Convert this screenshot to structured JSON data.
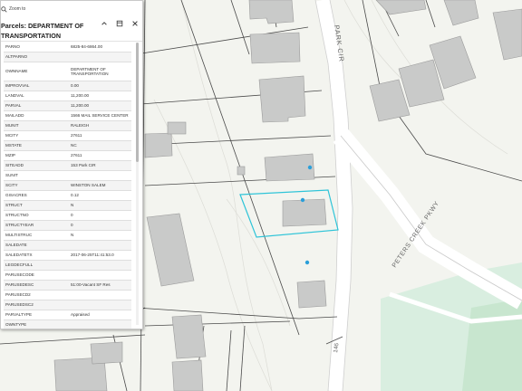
{
  "map": {
    "road_labels": [
      "PARK CIR",
      "PETERS CREEK PKWY",
      "146"
    ],
    "colors": {
      "background": "#f3f4ef",
      "building": "#c9cac9",
      "building_stroke": "#9b9b9b",
      "parcel_line": "#4a4a4a",
      "road": "#ffffff",
      "park": "#d9eee0",
      "highlight": "#2ec4d8",
      "marker": "#2b9fd9"
    }
  },
  "popup": {
    "zoom_label": "Zoom to",
    "title": "Parcels: DEPARTMENT OF TRANSPORTATION",
    "icons": [
      "chevron-up-icon",
      "dock-icon",
      "close-icon"
    ],
    "rows": [
      {
        "field": "PARNO",
        "value": "6825-84-6864.00"
      },
      {
        "field": "ALTPARNO",
        "value": ""
      },
      {
        "field": "OWNNAME",
        "value": "DEPARTMENT OF TRANSPORTATION"
      },
      {
        "field": "IMPROVVAL",
        "value": "0.00"
      },
      {
        "field": "LANDVAL",
        "value": "11,200.00"
      },
      {
        "field": "PARVAL",
        "value": "11,200.00"
      },
      {
        "field": "MAILADD",
        "value": "1566 MAIL SERVICE CENTER"
      },
      {
        "field": "MUNIT",
        "value": "RALEIGH"
      },
      {
        "field": "MCITY",
        "value": "27611"
      },
      {
        "field": "MSTATE",
        "value": "NC"
      },
      {
        "field": "MZIP",
        "value": "27611"
      },
      {
        "field": "SITEADD",
        "value": "153 Park CIR"
      },
      {
        "field": "SUNIT",
        "value": ""
      },
      {
        "field": "SCITY",
        "value": "WINSTON SALEM"
      },
      {
        "field": "GISACRES",
        "value": "0.12"
      },
      {
        "field": "STRUCT",
        "value": "N"
      },
      {
        "field": "STRUCTNO",
        "value": "0"
      },
      {
        "field": "STRUCTYEAR",
        "value": "0"
      },
      {
        "field": "MULTISTRUC",
        "value": "N"
      },
      {
        "field": "SALEDATE",
        "value": ""
      },
      {
        "field": "SALEDATETX",
        "value": "2017-06-25T11:41:53.0"
      },
      {
        "field": "LEGDECFULL",
        "value": ""
      },
      {
        "field": "PARUSECODE",
        "value": ""
      },
      {
        "field": "PARUSEDESC",
        "value": "51:00-Vacant SF Res"
      },
      {
        "field": "PARUSECD2",
        "value": ""
      },
      {
        "field": "PARUSEDSC2",
        "value": ""
      },
      {
        "field": "PARVALTYPE",
        "value": "Appraised"
      },
      {
        "field": "OWNTYPE",
        "value": ""
      }
    ]
  }
}
